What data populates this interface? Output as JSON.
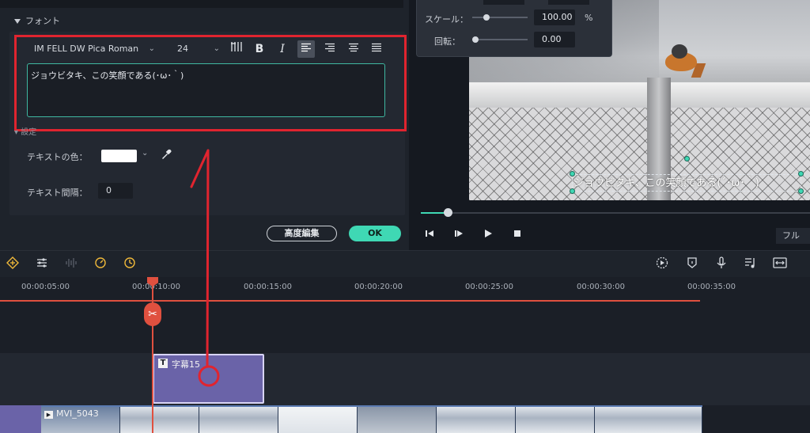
{
  "font_panel": {
    "section_title": "フォント",
    "font_family": "IM FELL DW Pica Roman",
    "font_size": "24",
    "text_content": "ジョウビタキ、この笑顔である(･ω･｀)"
  },
  "settings": {
    "section_title": "設定",
    "text_color_label": "テキストの色：",
    "text_color_value": "#ffffff",
    "text_spacing_label": "テキスト間隔：",
    "text_spacing_value": "0"
  },
  "buttons": {
    "advanced_label": "高度編集",
    "ok_label": "OK"
  },
  "inspector": {
    "scale_label": "スケール：",
    "scale_value": "100.00",
    "scale_unit": "%",
    "rotate_label": "回転：",
    "rotate_value": "0.00"
  },
  "preview": {
    "subtitle": "ジョウビタキ、この笑顔である(´･ω･｀)",
    "fullscreen_label": "フル"
  },
  "timeline": {
    "ticks": [
      "00:00:05:00",
      "00:00:10:00",
      "00:00:15:00",
      "00:00:20:00",
      "00:00:25:00",
      "00:00:30:00",
      "00:00:35:00"
    ],
    "title_clip_name": "字幕15",
    "video_clip_name": "MVI_5043"
  },
  "icons": {
    "bold": "B",
    "italic": "I",
    "cut": "✂"
  },
  "colors": {
    "accent": "#3fd8b4",
    "highlight_red": "#e0242f",
    "playhead": "#e0503f",
    "title_clip": "#6a63a8"
  }
}
